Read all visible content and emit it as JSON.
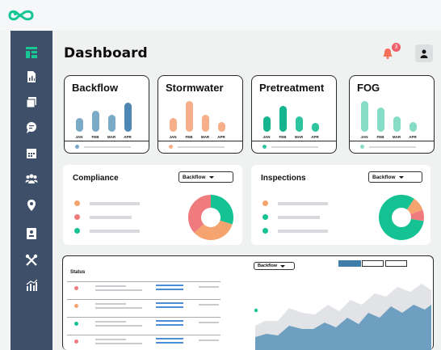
{
  "app": {
    "logo": "infinity-logo"
  },
  "header": {
    "title": "Dashboard",
    "notification_count": "3"
  },
  "sidebar": {
    "items": [
      "dashboard-icon",
      "report-icon",
      "documents-icon",
      "chat-icon",
      "calendar-icon",
      "users-icon",
      "location-icon",
      "contact-card-icon",
      "tools-icon",
      "analytics-icon"
    ]
  },
  "cards": [
    {
      "title": "Backflow",
      "color": "#7aaac5",
      "accent": "#4f87b4",
      "months": [
        "JAN",
        "FEB",
        "MAR",
        "APR"
      ],
      "values": [
        0.45,
        0.68,
        0.55,
        0.95
      ]
    },
    {
      "title": "Stormwater",
      "color": "#f7ae8a",
      "accent": "#f58c62",
      "months": [
        "JAN",
        "FEB",
        "MAR",
        "APR"
      ],
      "values": [
        0.45,
        1.0,
        0.55,
        0.32
      ]
    },
    {
      "title": "Pretreatment",
      "color": "#2ec4a0",
      "accent": "#14b58e",
      "months": [
        "JAN",
        "FEB",
        "MAR",
        "APR"
      ],
      "values": [
        0.5,
        0.85,
        0.5,
        0.3
      ]
    },
    {
      "title": "FOG",
      "color": "#86dcc6",
      "accent": "#49c9a6",
      "months": [
        "JAN",
        "FEB",
        "MAR",
        "APR"
      ],
      "values": [
        1.0,
        0.8,
        0.5,
        0.32
      ]
    }
  ],
  "compliance": {
    "title": "Compliance",
    "dropdown": "Backflow",
    "legend_colors": [
      "#f5a36f",
      "#f07b7e",
      "#14c294"
    ],
    "slices": [
      0.3,
      0.33,
      0.37
    ]
  },
  "inspections": {
    "title": "Inspections",
    "dropdown": "Backflow",
    "legend_colors": [
      "#f5a36f",
      "#14c294",
      "#14c294"
    ],
    "slices": [
      0.1,
      0.08,
      0.82
    ]
  },
  "status": {
    "title": "Status",
    "dropdown": "Backflow",
    "row_dot_colors": [
      "#f07b7e",
      "#f5a36f",
      "#14c294",
      "#f07b7e"
    ]
  }
}
